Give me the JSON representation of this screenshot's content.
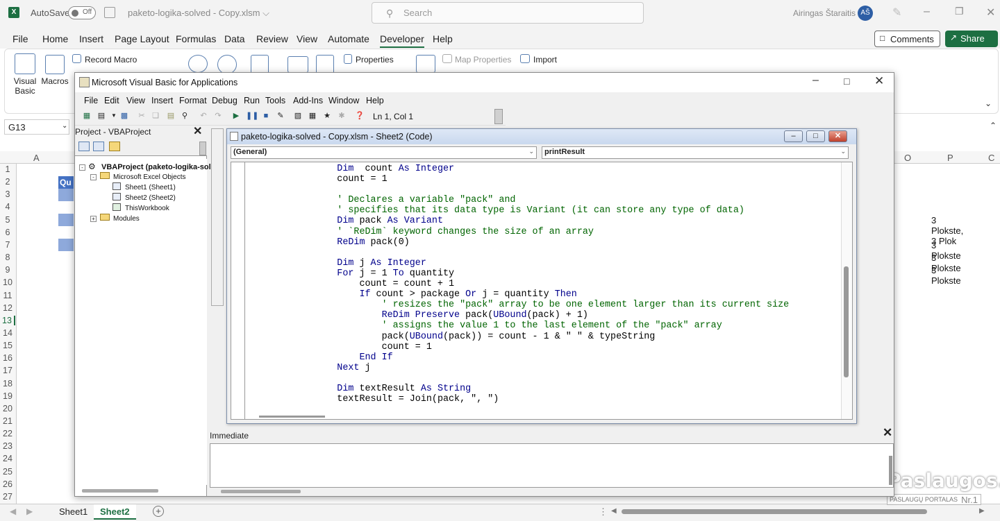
{
  "excel": {
    "autosave_label": "AutoSave",
    "autosave_state": "Off",
    "doc_title": "paketo-logika-solved - Copy.xlsm ⌵",
    "search_placeholder": "Search",
    "user_name": "Airingas Štaraitis",
    "user_initials": "AŠ",
    "ribbon_tabs": [
      "File",
      "Home",
      "Insert",
      "Page Layout",
      "Formulas",
      "Data",
      "Review",
      "View",
      "Automate",
      "Developer",
      "Help"
    ],
    "active_tab": "Developer",
    "comments_label": "Comments",
    "share_label": "Share",
    "ribbon": {
      "visual_basic": "Visual Basic",
      "macros": "Macros",
      "record_macro": "Record Macro",
      "properties": "Properties",
      "map_properties": "Map Properties",
      "import": "Import"
    },
    "name_box": "G13",
    "columns": [
      "A",
      "O",
      "P",
      "C"
    ],
    "rows": [
      "1",
      "2",
      "3",
      "4",
      "5",
      "6",
      "7",
      "8",
      "9",
      "10",
      "11",
      "12",
      "13",
      "14",
      "15",
      "16",
      "17",
      "18",
      "19",
      "20",
      "21",
      "22",
      "23",
      "24",
      "25",
      "26",
      "27"
    ],
    "selected_row": "13",
    "cell_q2": "Qu",
    "cells_p": [
      {
        "row": "5",
        "text": "3 Plokste, 3 Plok"
      },
      {
        "row": "7",
        "text": "3 Plokste"
      },
      {
        "row": "8",
        "text": "3 Plokste"
      },
      {
        "row": "9",
        "text": "3 Plokste"
      }
    ],
    "sheet_tabs": [
      "Sheet1",
      "Sheet2"
    ],
    "active_sheet": "Sheet2"
  },
  "vba": {
    "window_title": "Microsoft Visual Basic for Applications",
    "menu": [
      "File",
      "Edit",
      "View",
      "Insert",
      "Format",
      "Debug",
      "Run",
      "Tools",
      "Add-Ins",
      "Window",
      "Help"
    ],
    "cursor_pos": "Ln 1, Col 1",
    "project_title": "Project - VBAProject",
    "tree": {
      "root": "VBAProject (paketo-logika-sol",
      "excel_objects": "Microsoft Excel Objects",
      "sheet1": "Sheet1 (Sheet1)",
      "sheet2": "Sheet2 (Sheet2)",
      "workbook": "ThisWorkbook",
      "modules": "Modules"
    },
    "code_window_title": "paketo-logika-solved - Copy.xlsm - Sheet2 (Code)",
    "object_combo": "(General)",
    "proc_combo": "printResult",
    "code_lines": [
      {
        "indent": "        ",
        "parts": [
          [
            "kw",
            "Dim"
          ],
          [
            "",
            "  count "
          ],
          [
            "kw",
            "As"
          ],
          [
            "",
            ""
          ],
          [
            "kw",
            " Integer"
          ]
        ]
      },
      {
        "indent": "        ",
        "parts": [
          [
            "",
            "count = 1"
          ]
        ]
      },
      {
        "indent": "",
        "parts": [
          [
            "",
            ""
          ]
        ]
      },
      {
        "indent": "        ",
        "parts": [
          [
            "cm",
            "' Declares a variable \"pack\" and"
          ]
        ]
      },
      {
        "indent": "        ",
        "parts": [
          [
            "cm",
            "' specifies that its data type is Variant (it can store any type of data)"
          ]
        ]
      },
      {
        "indent": "        ",
        "parts": [
          [
            "kw",
            "Dim"
          ],
          [
            "",
            " pack "
          ],
          [
            "kw",
            "As"
          ],
          [
            "",
            " "
          ],
          [
            "kw",
            "Variant"
          ]
        ]
      },
      {
        "indent": "        ",
        "parts": [
          [
            "cm",
            "' `ReDim` keyword changes the size of an array"
          ]
        ]
      },
      {
        "indent": "        ",
        "parts": [
          [
            "kw",
            "ReDim"
          ],
          [
            "",
            " pack(0)"
          ]
        ]
      },
      {
        "indent": "",
        "parts": [
          [
            "",
            ""
          ]
        ]
      },
      {
        "indent": "        ",
        "parts": [
          [
            "kw",
            "Dim"
          ],
          [
            "",
            " j "
          ],
          [
            "kw",
            "As Integer"
          ]
        ]
      },
      {
        "indent": "        ",
        "parts": [
          [
            "kw",
            "For"
          ],
          [
            "",
            " j = 1 "
          ],
          [
            "kw",
            "To"
          ],
          [
            "",
            " quantity"
          ]
        ]
      },
      {
        "indent": "            ",
        "parts": [
          [
            "",
            "count = count + 1"
          ]
        ]
      },
      {
        "indent": "            ",
        "parts": [
          [
            "kw",
            "If"
          ],
          [
            "",
            " count > package "
          ],
          [
            "kw",
            "Or"
          ],
          [
            "",
            " j = quantity "
          ],
          [
            "kw",
            "Then"
          ]
        ]
      },
      {
        "indent": "                ",
        "parts": [
          [
            "cm",
            "' resizes the \"pack\" array to be one element larger than its current size"
          ]
        ]
      },
      {
        "indent": "                ",
        "parts": [
          [
            "kw",
            "ReDim Preserve"
          ],
          [
            "",
            " pack("
          ],
          [
            "kw",
            "UBound"
          ],
          [
            "",
            "(pack) + 1)"
          ]
        ]
      },
      {
        "indent": "                ",
        "parts": [
          [
            "cm",
            "' assigns the value 1 to the last element of the \"pack\" array"
          ]
        ]
      },
      {
        "indent": "                ",
        "parts": [
          [
            "",
            "pack("
          ],
          [
            "kw",
            "UBound"
          ],
          [
            "",
            "(pack)) = count - 1 & \" \" & typeString"
          ]
        ]
      },
      {
        "indent": "                ",
        "parts": [
          [
            "",
            "count = 1"
          ]
        ]
      },
      {
        "indent": "            ",
        "parts": [
          [
            "kw",
            "End If"
          ]
        ]
      },
      {
        "indent": "        ",
        "parts": [
          [
            "kw",
            "Next"
          ],
          [
            "",
            " j"
          ]
        ]
      },
      {
        "indent": "",
        "parts": [
          [
            "",
            ""
          ]
        ]
      },
      {
        "indent": "        ",
        "parts": [
          [
            "kw",
            "Dim"
          ],
          [
            "",
            " textResult "
          ],
          [
            "kw",
            "As String"
          ]
        ]
      },
      {
        "indent": "        ",
        "parts": [
          [
            "",
            "textResult = Join(pack, \", \")"
          ]
        ]
      }
    ],
    "immediate_title": "Immediate"
  },
  "watermark": {
    "brand": "Paslaugos.lt",
    "sub": "PASLAUGŲ PORTALAS",
    "nr": "Nr.1"
  },
  "colors": {
    "excel_green": "#1d6f42",
    "vba_keyword": "#00008b",
    "vba_comment": "#006400",
    "header_blue": "#4472c4"
  }
}
